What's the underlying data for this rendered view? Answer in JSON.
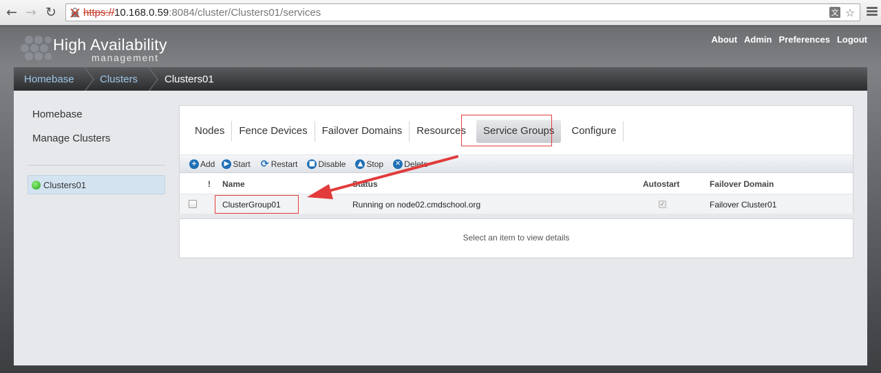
{
  "browser": {
    "url_scheme": "https://",
    "url_host": "10.168.0.59",
    "url_rest": ":8084/cluster/Clusters01/services",
    "back_icon": "back-arrow-icon",
    "forward_icon": "forward-arrow-icon",
    "reload_icon": "reload-icon",
    "lock_icon": "broken-lock-icon",
    "translate_icon": "translate-icon",
    "bookmark_icon": "star-icon",
    "menu_icon": "hamburger-menu-icon"
  },
  "header": {
    "title": "High Availability",
    "subtitle": "management",
    "links": [
      "About",
      "Admin",
      "Preferences",
      "Logout"
    ]
  },
  "breadcrumb": [
    "Homebase",
    "Clusters",
    "Clusters01"
  ],
  "sidebar": {
    "links": [
      "Homebase",
      "Manage Clusters"
    ],
    "cluster": {
      "label": "Clusters01",
      "status_color": "#2fb522"
    }
  },
  "tabs": [
    "Nodes",
    "Fence Devices",
    "Failover Domains",
    "Resources",
    "Service Groups",
    "Configure"
  ],
  "active_tab": "Service Groups",
  "toolbar": [
    "Add",
    "Start",
    "Restart",
    "Disable",
    "Stop",
    "Delete"
  ],
  "grid": {
    "headers": {
      "flag": "!",
      "name": "Name",
      "status": "Status",
      "autostart": "Autostart",
      "domain": "Failover Domain"
    },
    "rows": [
      {
        "name": "ClusterGroup01",
        "status": "Running on node02.cmdschool.org",
        "autostart": true,
        "domain": "Failover Cluster01"
      }
    ]
  },
  "details_placeholder": "Select an item to view details",
  "colors": {
    "link": "#9fc7e8",
    "annotation": "#e23b3b",
    "toolbar_icon": "#1f6fb5"
  }
}
